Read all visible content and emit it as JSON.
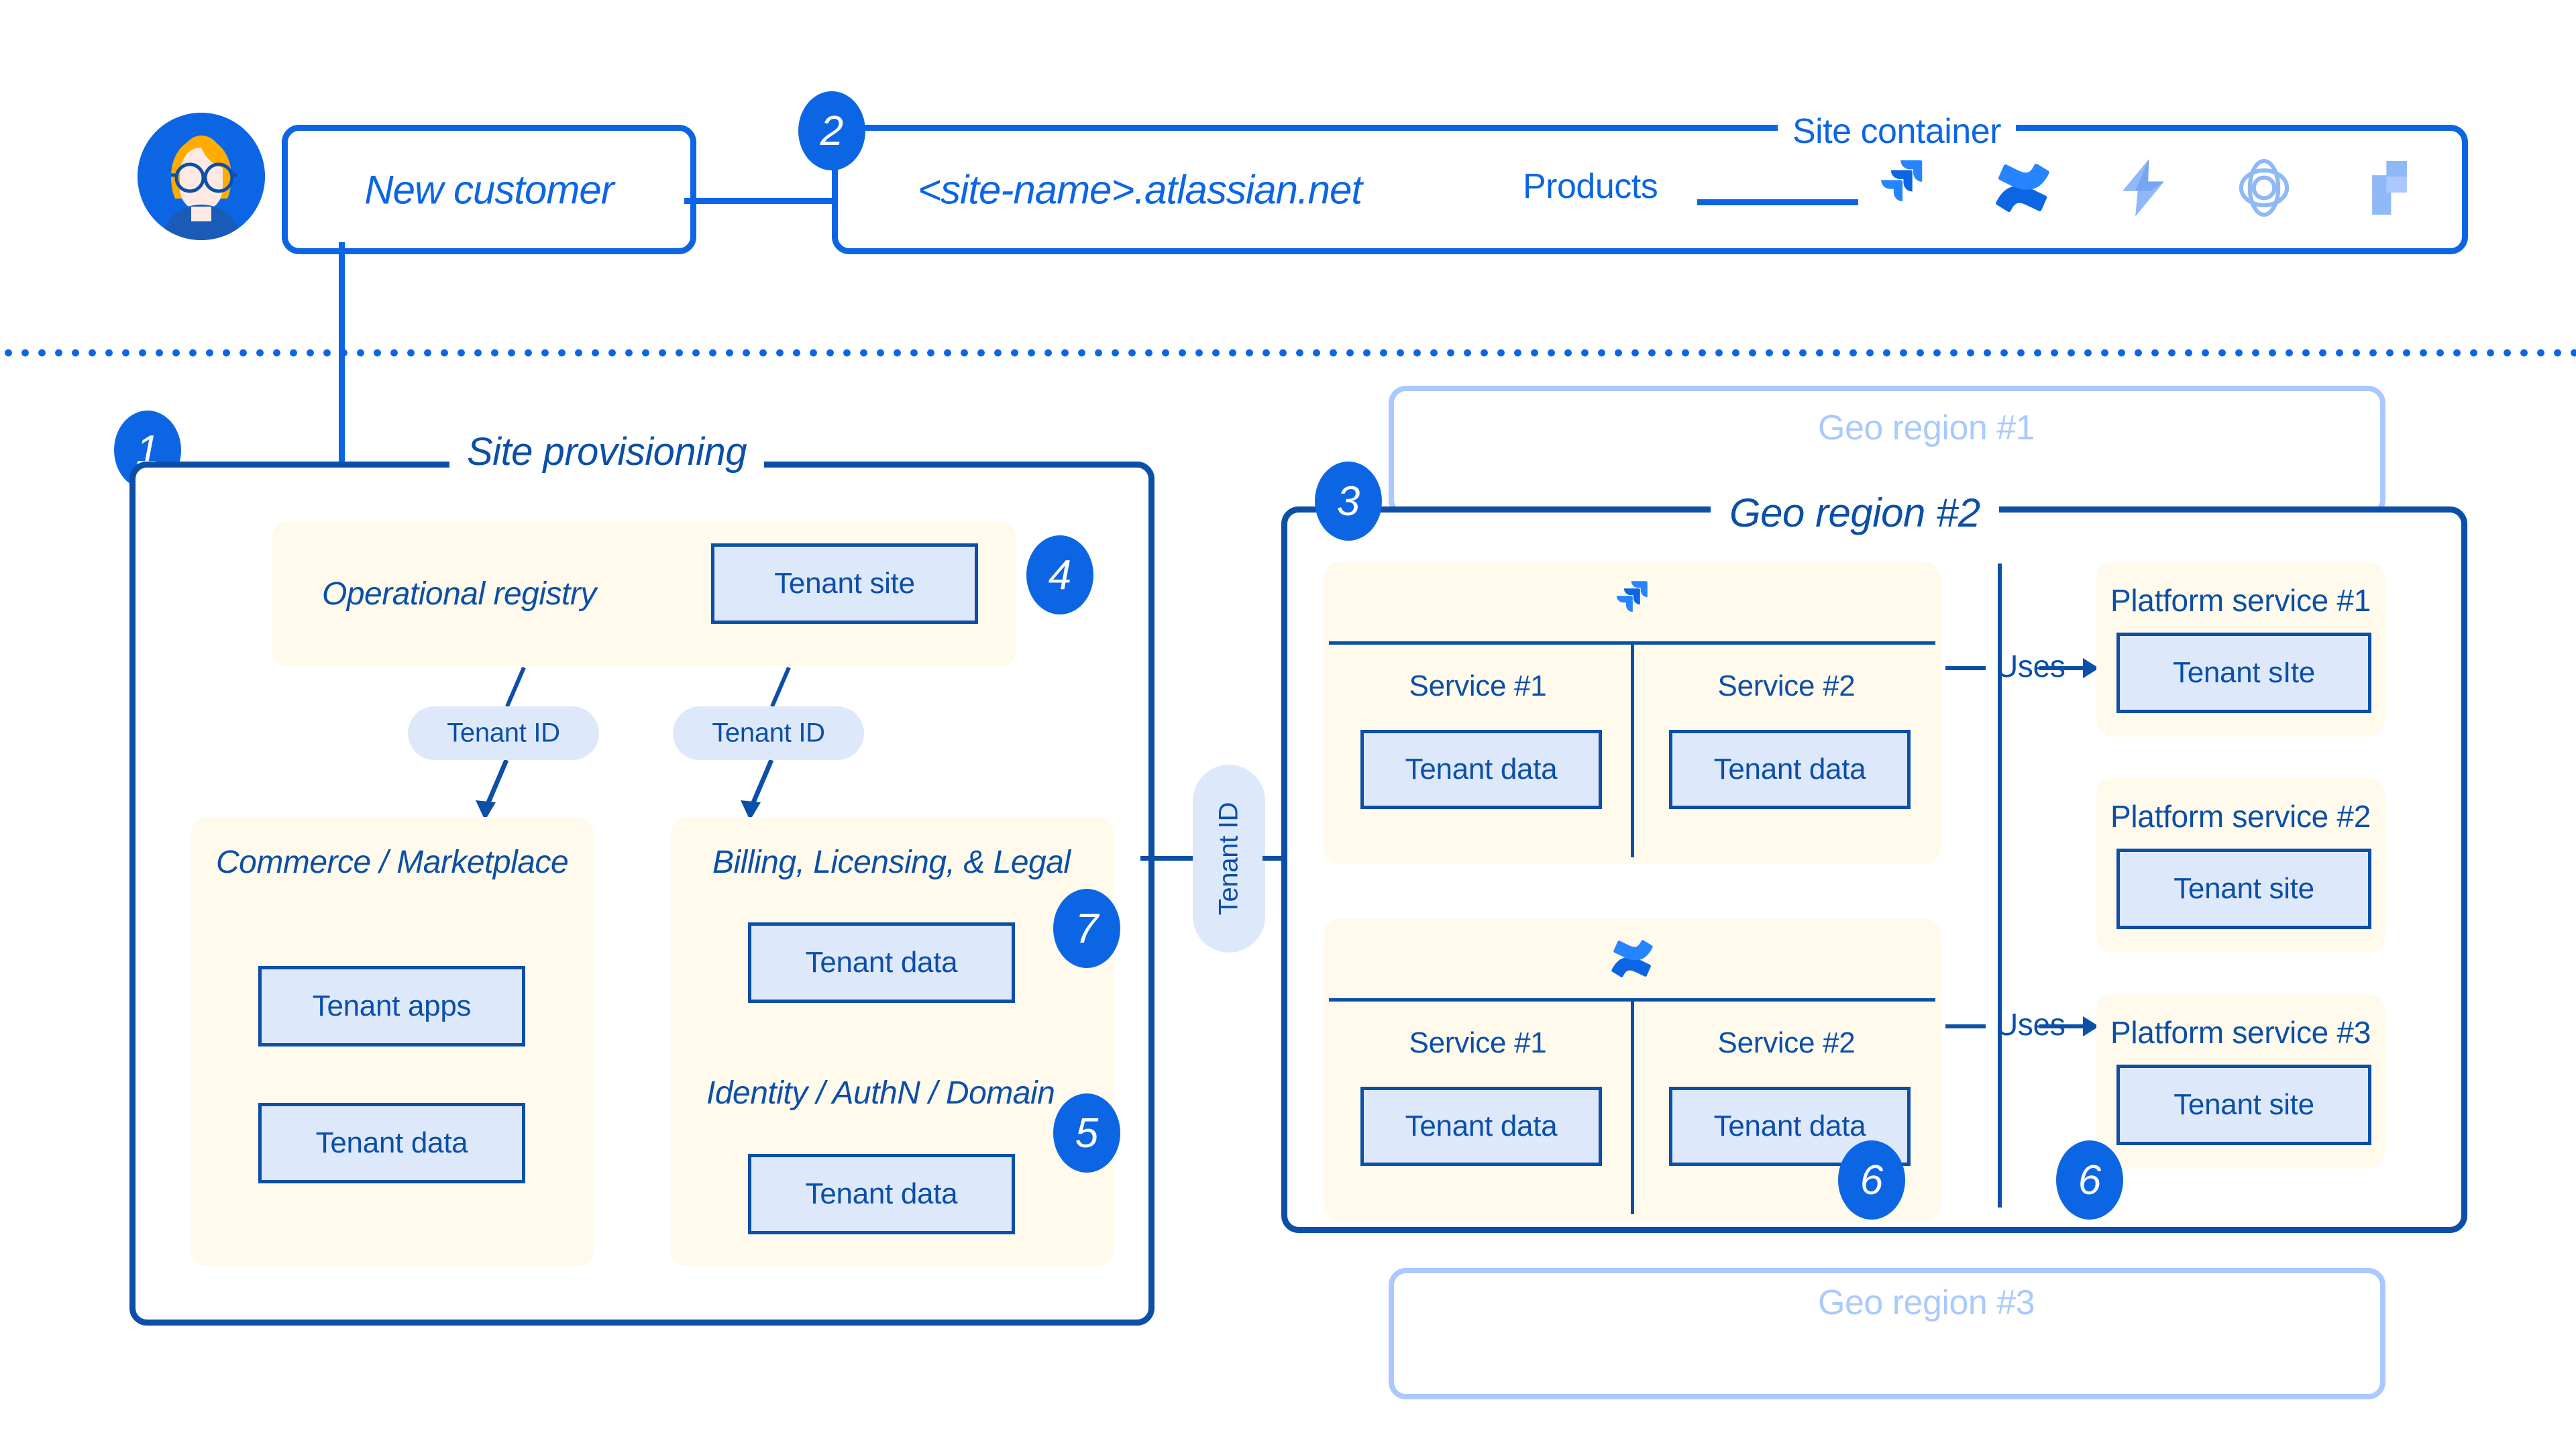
{
  "top": {
    "avatar_icon": "user-avatar-icon",
    "new_customer_label": "New customer",
    "site_name_label": "<site-name>.atlassian.net",
    "site_container_title": "Site container",
    "products_label": "Products",
    "product_icons": [
      {
        "name": "jira-icon",
        "label": "Jira"
      },
      {
        "name": "confluence-icon",
        "label": "Confluence"
      },
      {
        "name": "jira-service-management-icon",
        "label": "Jira Service Management"
      },
      {
        "name": "compass-icon",
        "label": "Compass"
      },
      {
        "name": "bitbucket-icon",
        "label": "Bitbucket"
      }
    ]
  },
  "badges": {
    "one": "1",
    "two": "2",
    "three": "3",
    "four": "4",
    "five": "5",
    "six_a": "6",
    "six_b": "6",
    "seven": "7"
  },
  "provisioning": {
    "title": "Site provisioning",
    "operational_registry": {
      "label": "Operational registry",
      "tenant_site_box": "Tenant site"
    },
    "pills": [
      {
        "label": "Tenant ID"
      },
      {
        "label": "Tenant ID"
      }
    ],
    "commerce": {
      "label": "Commerce / Marketplace",
      "boxes": [
        "Tenant apps",
        "Tenant data"
      ]
    },
    "billing": {
      "label": "Billing, Licensing, & Legal",
      "boxes": [
        "Tenant data"
      ]
    },
    "identity": {
      "label": "Identity / AuthN / Domain",
      "boxes": [
        "Tenant data"
      ]
    }
  },
  "connector": {
    "tenant_id_pill": "Tenant ID"
  },
  "geo": {
    "region1_label": "Geo region #1",
    "region3_label": "Geo region #3",
    "region2_title": "Geo region #2",
    "product_groups": [
      {
        "icon": "jira-icon",
        "services": [
          {
            "name": "Service #1",
            "box": "Tenant data"
          },
          {
            "name": "Service #2",
            "box": "Tenant data"
          }
        ]
      },
      {
        "icon": "confluence-icon",
        "services": [
          {
            "name": "Service #1",
            "box": "Tenant data"
          },
          {
            "name": "Service #2",
            "box": "Tenant data"
          }
        ]
      }
    ],
    "uses_label_top": "Uses",
    "uses_label_bottom": "Uses",
    "platform_services": [
      {
        "title": "Platform service #1",
        "box": "Tenant sIte"
      },
      {
        "title": "Platform service #2",
        "box": "Tenant site"
      },
      {
        "title": "Platform service #3",
        "box": "Tenant site"
      }
    ]
  },
  "colors": {
    "brand_blue": "#0C66E4",
    "deep_blue": "#0B4FA8",
    "cream": "#FFFAEB",
    "light_blue": "#DEE8FB",
    "ghost_blue": "#A9C9FF"
  }
}
